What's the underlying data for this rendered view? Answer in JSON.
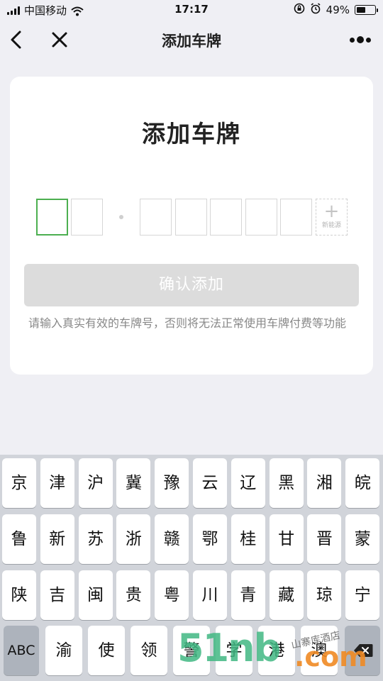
{
  "status_bar": {
    "carrier": "中国移动",
    "time": "17:17",
    "battery": "49%"
  },
  "nav": {
    "title": "添加车牌"
  },
  "card": {
    "title": "添加车牌",
    "new_energy_label": "新能源",
    "new_energy_plus": "+",
    "confirm_label": "确认添加",
    "hint": "请输入真实有效的车牌号，否则将无法正常使用车牌付费等功能"
  },
  "keyboard": {
    "rows": [
      [
        "京",
        "津",
        "沪",
        "冀",
        "豫",
        "云",
        "辽",
        "黑",
        "湘",
        "皖"
      ],
      [
        "鲁",
        "新",
        "苏",
        "浙",
        "赣",
        "鄂",
        "桂",
        "甘",
        "晋",
        "蒙"
      ],
      [
        "陕",
        "吉",
        "闽",
        "贵",
        "粤",
        "川",
        "青",
        "藏",
        "琼",
        "宁"
      ]
    ],
    "bottom_row": [
      "渝",
      "使",
      "领",
      "警",
      "学",
      "港",
      "澳"
    ],
    "abc_label": "ABC"
  },
  "watermark": {
    "text": "51nb",
    "domain": ".com",
    "cn": "山寨库酒店"
  },
  "colors": {
    "active_border": "#4CAF50",
    "confirm_bg": "#DCDCDC",
    "keyboard_bg": "#D1D4DA"
  }
}
